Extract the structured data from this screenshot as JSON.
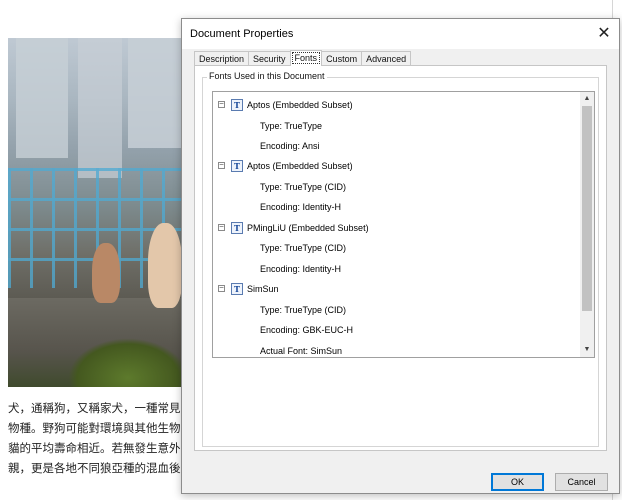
{
  "document": {
    "text_lines": [
      "犬，通稱狗，又稱家犬，一種常見",
      "物種。野狗可能對環境與其他生物",
      "貓的平均壽命相近。若無發生意外",
      "親，更是各地不同狼亞種的混血後"
    ]
  },
  "dialog": {
    "title": "Document Properties",
    "close_icon": "close-icon",
    "tabs": [
      {
        "label": "Description",
        "active": false
      },
      {
        "label": "Security",
        "active": false
      },
      {
        "label": "Fonts",
        "active": true
      },
      {
        "label": "Custom",
        "active": false
      },
      {
        "label": "Advanced",
        "active": false
      }
    ],
    "group_label": "Fonts Used in this Document",
    "fonts": [
      {
        "name": "Aptos (Embedded Subset)",
        "details": [
          "Type: TrueType",
          "Encoding: Ansi"
        ]
      },
      {
        "name": "Aptos (Embedded Subset)",
        "details": [
          "Type: TrueType (CID)",
          "Encoding: Identity-H"
        ]
      },
      {
        "name": "PMingLiU (Embedded Subset)",
        "details": [
          "Type: TrueType (CID)",
          "Encoding: Identity-H"
        ]
      },
      {
        "name": "SimSun",
        "details": [
          "Type: TrueType (CID)",
          "Encoding: GBK-EUC-H",
          "Actual Font: SimSun"
        ]
      }
    ],
    "expander_symbol": "⊟",
    "font_icon_glyph": "T",
    "buttons": {
      "ok": "OK",
      "cancel": "Cancel"
    }
  }
}
